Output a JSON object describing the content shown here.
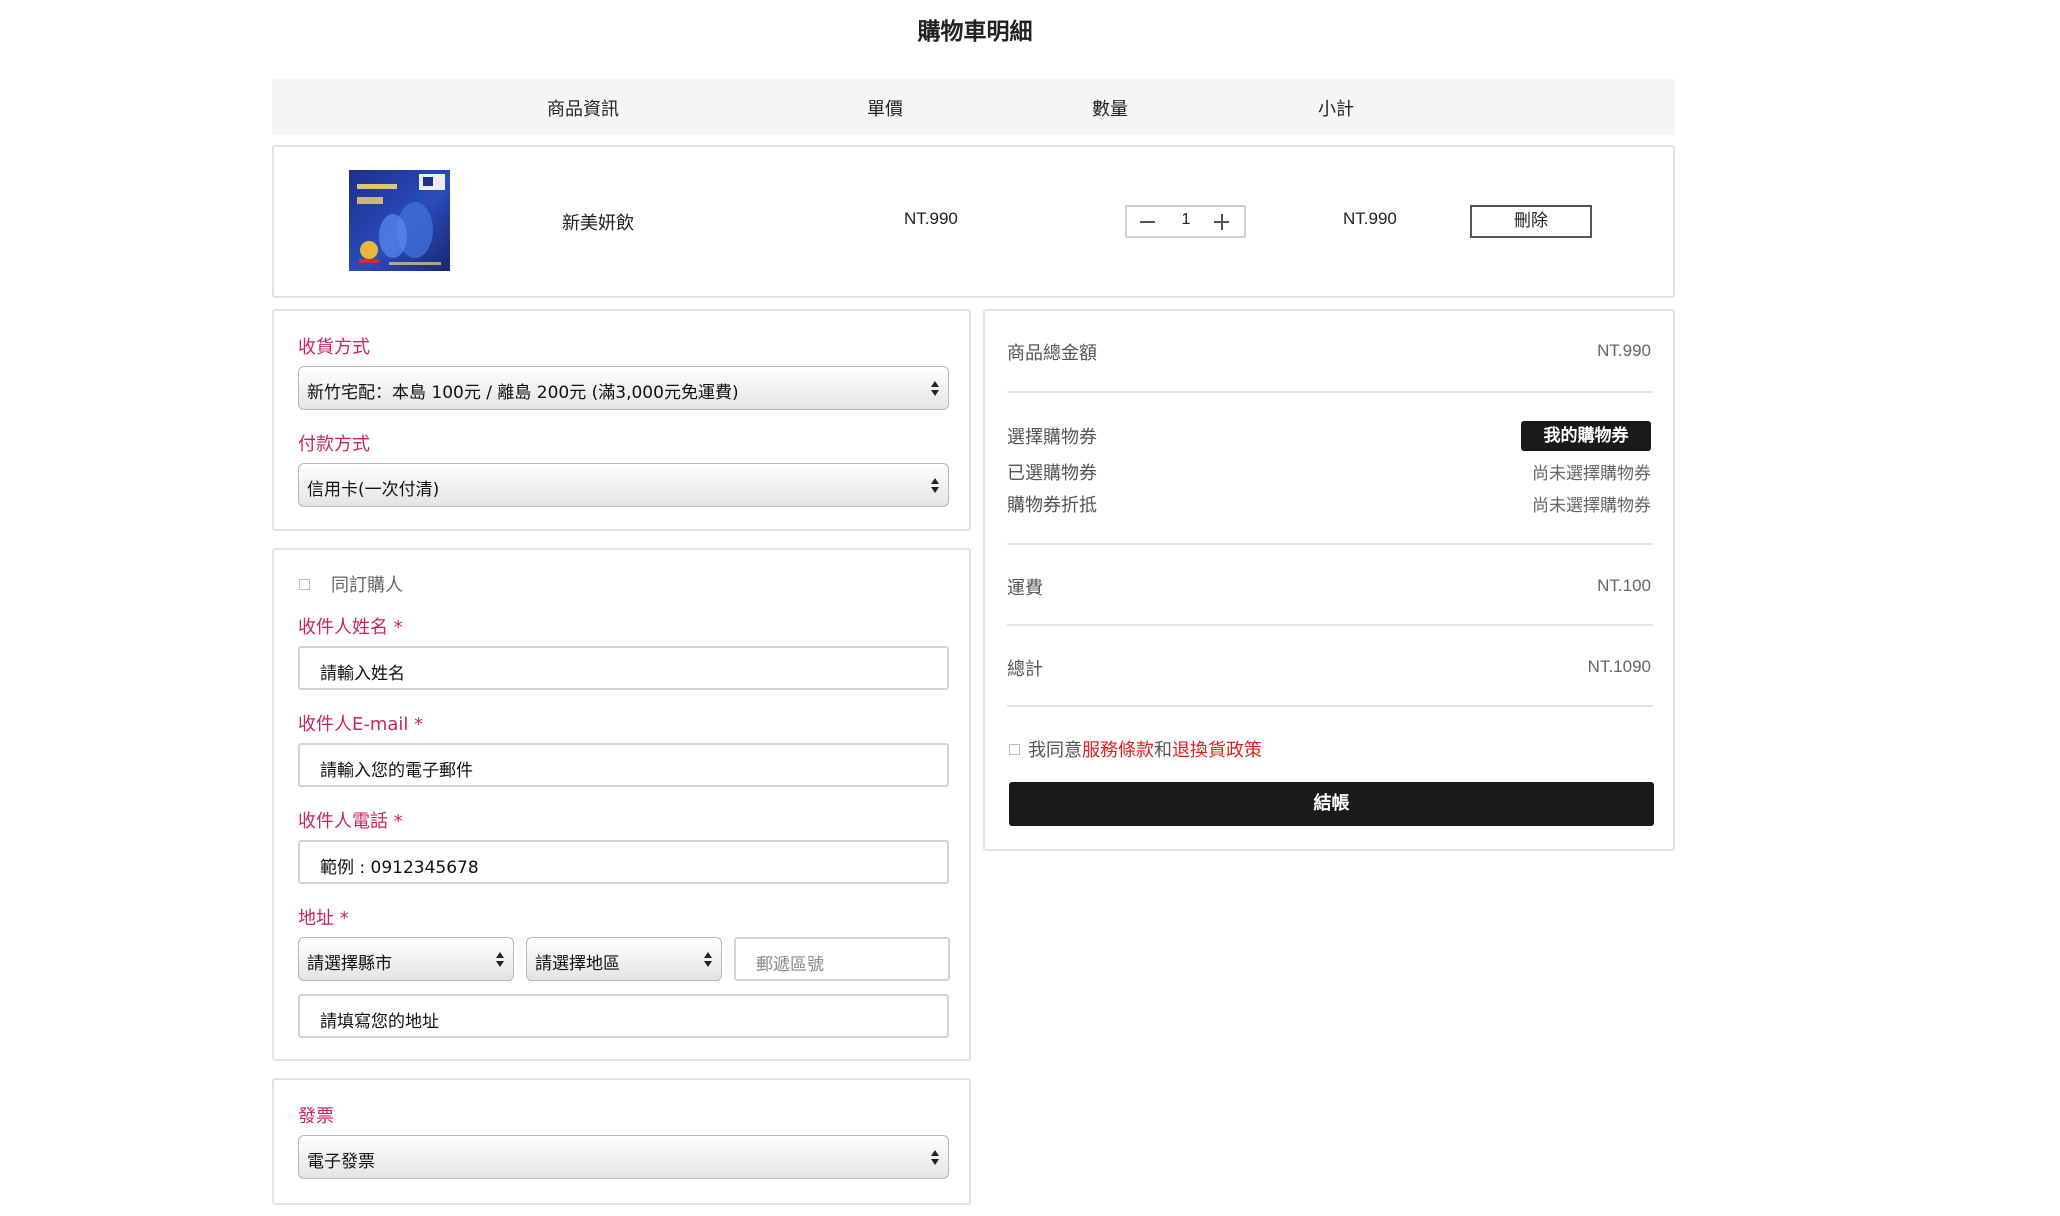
{
  "title": "購物車明細",
  "cart_header": {
    "product_info": "商品資訊",
    "unit_price": "單價",
    "quantity": "數量",
    "subtotal": "小計"
  },
  "item": {
    "name": "新美妍飲",
    "unit_price": "NT.990",
    "quantity": "1",
    "subtotal": "NT.990",
    "delete_label": "刪除",
    "image_name": "product-image"
  },
  "shipping": {
    "delivery_label": "收貨方式",
    "delivery_value": "新竹宅配：本島 100元 / 離島 200元 (滿3,000元免運費)",
    "payment_label": "付款方式",
    "payment_value": "信用卡(一次付清)"
  },
  "recipient": {
    "same_as_buyer": "同訂購人",
    "name_label": "收件人姓名 *",
    "name_placeholder": "請輸入姓名",
    "email_label": "收件人E-mail *",
    "email_placeholder": "請輸入您的電子郵件",
    "phone_label": "收件人電話 *",
    "phone_placeholder": "範例 : 0912345678",
    "address_label": "地址 *",
    "city_select": "請選擇縣市",
    "district_select": "請選擇地區",
    "zip_placeholder": "郵遞區號",
    "address_placeholder": "請填寫您的地址"
  },
  "invoice": {
    "label": "發票",
    "value": "電子發票"
  },
  "summary": {
    "product_total_label": "商品總金額",
    "product_total_value": "NT.990",
    "choose_coupon_label": "選擇購物券",
    "my_coupon_button": "我的購物券",
    "selected_coupon_label": "已選購物券",
    "selected_coupon_value": "尚未選擇購物券",
    "coupon_discount_label": "購物券折抵",
    "coupon_discount_value": "尚未選擇購物券",
    "shipping_label": "運費",
    "shipping_value": "NT.100",
    "total_label": "總計",
    "total_value": "NT.1090",
    "agree_prefix": "我同意",
    "terms_link": "服務條款",
    "agree_and": "和",
    "return_link": "退換貨政策",
    "checkout_button": "結帳"
  },
  "colors": {
    "accent_pink": "#c8265a",
    "link_red": "#e0211f",
    "dark_button": "#1a1a1a"
  }
}
